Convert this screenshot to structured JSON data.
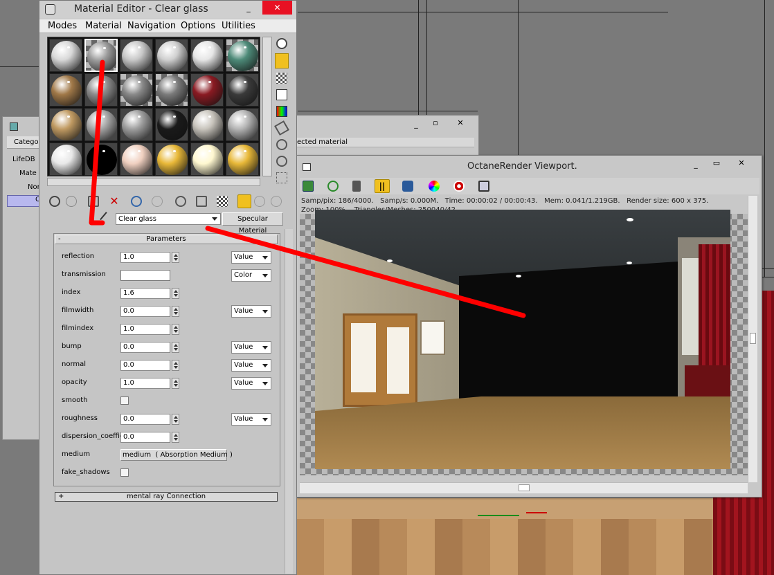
{
  "material_editor": {
    "title": "Material Editor - Clear glass",
    "menu": [
      "Modes",
      "Material",
      "Navigation",
      "Options",
      "Utilities"
    ],
    "material_name": "Clear glass",
    "material_type": "Specular Material",
    "rollout_parameters": "Parameters",
    "rollout_parameters_sign": "-",
    "rollout_mentalray": "mental ray Connection",
    "rollout_mentalray_sign": "+",
    "params": {
      "reflection": {
        "label": "reflection",
        "value": "1.0",
        "mode": "Value"
      },
      "transmission": {
        "label": "transmission",
        "mode": "Color"
      },
      "index": {
        "label": "index",
        "value": "1.6"
      },
      "filmwidth": {
        "label": "filmwidth",
        "value": "0.0",
        "mode": "Value"
      },
      "filmindex": {
        "label": "filmindex",
        "value": "1.0"
      },
      "bump": {
        "label": "bump",
        "value": "0.0",
        "mode": "Value"
      },
      "normal": {
        "label": "normal",
        "value": "0.0",
        "mode": "Value"
      },
      "opacity": {
        "label": "opacity",
        "value": "1.0",
        "mode": "Value"
      },
      "smooth": {
        "label": "smooth"
      },
      "roughness": {
        "label": "roughness",
        "value": "0.0",
        "mode": "Value"
      },
      "dispersion": {
        "label": "dispersion_coeffic",
        "value": "0.0"
      },
      "medium": {
        "label": "medium",
        "value": "medium  ( Absorption Medium )"
      },
      "fake_shadows": {
        "label": "fake_shadows"
      }
    },
    "spheres": [
      {
        "color": "#d8d8d8",
        "type": "plain"
      },
      {
        "color": "#9a9a9a",
        "type": "checker"
      },
      {
        "color": "#c8c8c8",
        "type": "plain"
      },
      {
        "color": "#cfcfcf",
        "type": "plain"
      },
      {
        "color": "#e6e6e6",
        "type": "plain"
      },
      {
        "color": "#4d8a78",
        "type": "checker"
      },
      {
        "color": "#a07848",
        "type": "plain"
      },
      {
        "color": "#8c8c8c",
        "type": "plain"
      },
      {
        "color": "#888888",
        "type": "checker"
      },
      {
        "color": "#7a7a7a",
        "type": "checker"
      },
      {
        "color": "#8a1a22",
        "type": "plain"
      },
      {
        "color": "#3a3a3a",
        "type": "plain"
      },
      {
        "color": "#c09a62",
        "type": "plain"
      },
      {
        "color": "#a9a9a9",
        "type": "plain"
      },
      {
        "color": "#9e9e9e",
        "type": "plain"
      },
      {
        "color": "#1a1a1a",
        "type": "plain"
      },
      {
        "color": "#c8c4bc",
        "type": "plain"
      },
      {
        "color": "#b4b4b4",
        "type": "plain"
      },
      {
        "color": "#e8e8e8",
        "type": "plain"
      },
      {
        "color": "#000000",
        "type": "plain"
      },
      {
        "color": "#f0d0c0",
        "type": "plain"
      },
      {
        "color": "#e8b838",
        "type": "plain"
      },
      {
        "color": "#fff8d0",
        "type": "plain"
      },
      {
        "color": "#e8b838",
        "type": "plain"
      }
    ]
  },
  "back_panel": {
    "header": "Catego",
    "rows": [
      "LifeDB",
      "Mate",
      "Nor",
      "C"
    ]
  },
  "middle_window": {
    "text": "ected material"
  },
  "octane": {
    "title": "OctaneRender Viewport.",
    "stats_line1": "Samp/pix: 186/4000.   Samp/s: 0.000M.   Time: 00:00:02 / 00:00:43.   Mem: 0.041/1.219GB.   Render size: 600 x 375.",
    "stats_line2": "Zoom: 100%.   Triangles/Meshes: 250040/42"
  },
  "colors": {
    "accent_red": "#e81123",
    "panel_bg": "#c5c5c5",
    "titlebar_bg": "#cfcfcf",
    "annotation_red": "#ff0000"
  }
}
